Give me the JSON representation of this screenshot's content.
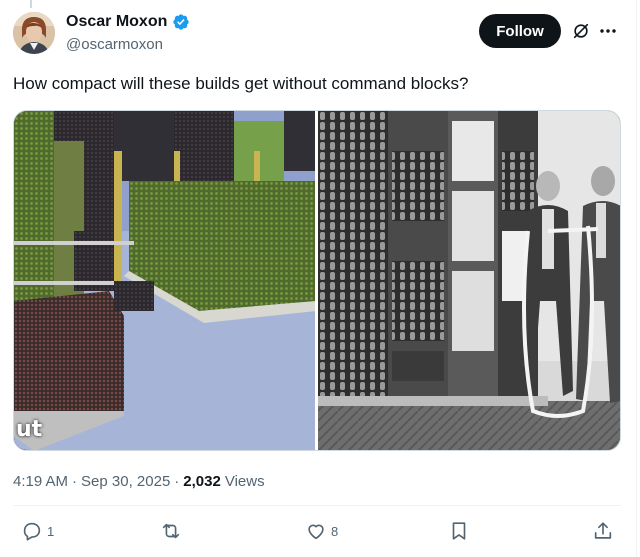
{
  "author": {
    "display_name": "Oscar Moxon",
    "handle": "@oscarmoxon",
    "verified": true
  },
  "header_actions": {
    "follow_label": "Follow",
    "grok_icon": "grok-icon",
    "more_icon": "more-icon"
  },
  "tweet": {
    "text": "How compact will these builds get without command blocks?",
    "media": {
      "left_caption": "ut",
      "left_alt": "Minecraft redstone computer build",
      "right_alt": "Historic computer with two men holding paper tape"
    }
  },
  "meta": {
    "time": "4:19 AM",
    "dot1": "·",
    "date": "Sep 30, 2025",
    "dot2": "·",
    "views_count": "2,032",
    "views_label": "Views"
  },
  "actions": {
    "reply_count": "1",
    "retweet_count": "",
    "like_count": "8"
  },
  "colors": {
    "text_primary": "#0f1419",
    "text_secondary": "#536471",
    "verified_blue": "#1d9bf0",
    "follow_bg": "#0f1419"
  }
}
